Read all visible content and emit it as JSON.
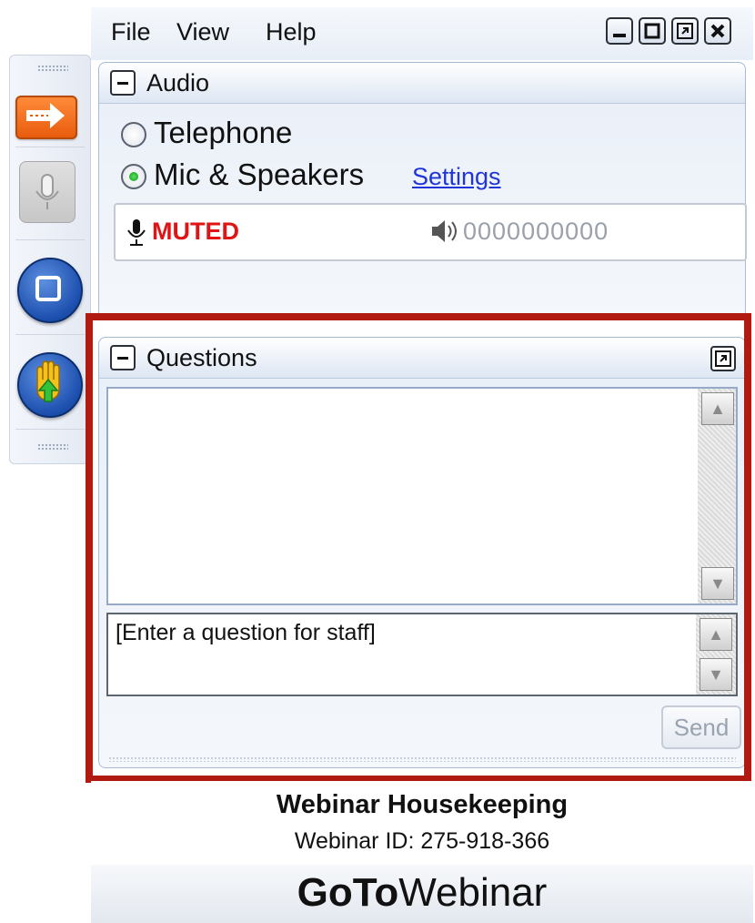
{
  "menu": {
    "file": "File",
    "view": "View",
    "help": "Help"
  },
  "audio": {
    "title": "Audio",
    "options": [
      {
        "label": "Telephone",
        "selected": false
      },
      {
        "label": "Mic & Speakers",
        "selected": true
      }
    ],
    "settings_link": "Settings",
    "status": "MUTED",
    "level_meter": "0000000000"
  },
  "questions": {
    "title": "Questions",
    "input_placeholder": "[Enter a question for staff]",
    "send_label": "Send"
  },
  "footer": {
    "title": "Webinar Housekeeping",
    "webinar_id": "Webinar ID: 275-918-366",
    "brand_bold": "GoTo",
    "brand_light": "Webinar"
  },
  "colors": {
    "accent_orange": "#e85c0d",
    "muted_red": "#e01414",
    "link_blue": "#1f35d8",
    "highlight_frame": "#b01a10",
    "radio_selected": "#0a9a12"
  },
  "icons": {
    "toolbar": [
      "arrow-right-icon",
      "microphone-icon",
      "screen-share-icon",
      "raise-hand-icon"
    ],
    "audio": [
      "microphone-icon",
      "speaker-icon"
    ],
    "window": [
      "minimize-icon",
      "maximize-icon",
      "restore-icon",
      "close-icon"
    ]
  }
}
